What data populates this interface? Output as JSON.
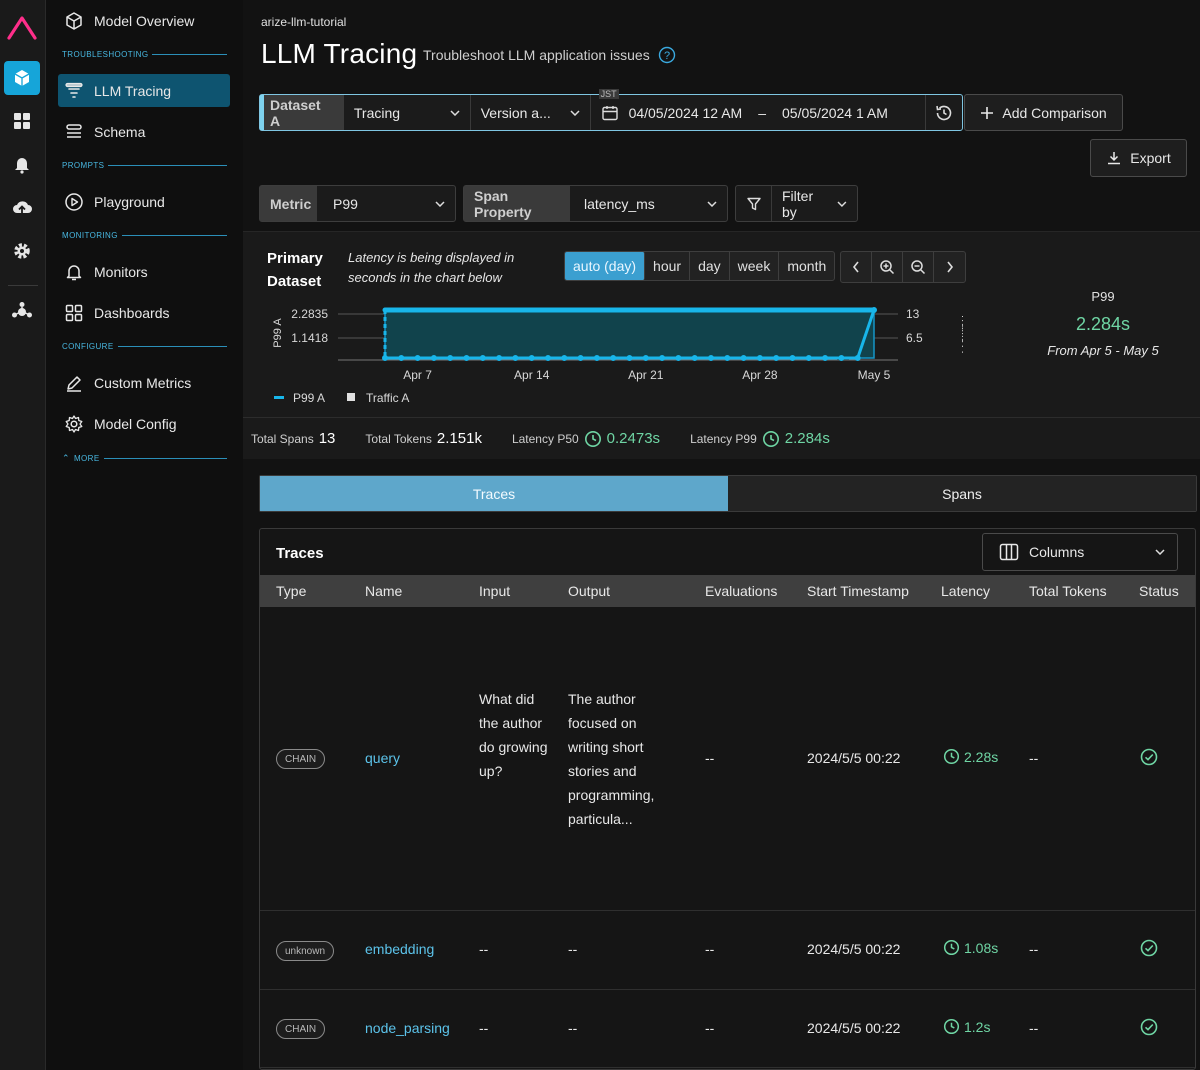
{
  "sidebar": {
    "items": [
      {
        "label": "Model Overview"
      },
      {
        "label": "LLM Tracing"
      },
      {
        "label": "Schema"
      },
      {
        "label": "Playground"
      },
      {
        "label": "Monitors"
      },
      {
        "label": "Dashboards"
      },
      {
        "label": "Custom Metrics"
      },
      {
        "label": "Model Config"
      }
    ],
    "sections": {
      "troubleshooting": "TROUBLESHOOTING",
      "prompts": "PROMPTS",
      "monitoring": "MONITORING",
      "configure": "CONFIGURE",
      "more": "MORE"
    }
  },
  "header": {
    "breadcrumb": "arize-llm-tutorial",
    "title": "LLM Tracing",
    "subtitle": "Troubleshoot LLM application issues"
  },
  "toolbar": {
    "dataset_label": "Dataset A",
    "dataset_value": "Tracing",
    "version_value": "Version a...",
    "timezone": "JST",
    "date_from": "04/05/2024 12 AM",
    "date_sep": "–",
    "date_to": "05/05/2024 1 AM",
    "add_comparison": "Add Comparison",
    "export": "Export",
    "metric_label": "Metric",
    "metric_value": "P99",
    "span_property_label": "Span Property",
    "span_property_value": "latency_ms",
    "filter_label": "Filter by"
  },
  "chart_panel": {
    "primary_label_1": "Primary",
    "primary_label_2": "Dataset",
    "note_1": "Latency is being displayed in",
    "note_2": "seconds in the chart below",
    "granularity": [
      "auto (day)",
      "hour",
      "day",
      "week",
      "month"
    ],
    "summary_metric": "P99",
    "summary_value": "2.284s",
    "summary_range": "From Apr 5 - May 5"
  },
  "chart_data": {
    "type": "line",
    "x": [
      "Apr 5",
      "Apr 6",
      "Apr 7",
      "Apr 8",
      "Apr 9",
      "Apr 10",
      "Apr 11",
      "Apr 12",
      "Apr 13",
      "Apr 14",
      "Apr 15",
      "Apr 16",
      "Apr 17",
      "Apr 18",
      "Apr 19",
      "Apr 20",
      "Apr 21",
      "Apr 22",
      "Apr 23",
      "Apr 24",
      "Apr 25",
      "Apr 26",
      "Apr 27",
      "Apr 28",
      "Apr 29",
      "Apr 30",
      "May 1",
      "May 2",
      "May 3",
      "May 4",
      "May 5"
    ],
    "x_tick_labels": [
      "Apr 7",
      "Apr 14",
      "Apr 21",
      "Apr 28",
      "May 5"
    ],
    "ylabel": "P99 A",
    "y2label": "Traffic A",
    "y_ticks": [
      "2.2835",
      "1.1418"
    ],
    "y2_ticks": [
      "13",
      "6.5"
    ],
    "ylim": [
      0,
      2.2835
    ],
    "y2lim": [
      0,
      13
    ],
    "series": [
      {
        "name": "P99 A",
        "axis": "left",
        "values": [
          2.2835,
          2.2835,
          2.2835,
          2.2835,
          2.2835,
          2.2835,
          2.2835,
          2.2835,
          2.2835,
          2.2835,
          2.2835,
          2.2835,
          2.2835,
          2.2835,
          2.2835,
          2.2835,
          2.2835,
          2.2835,
          2.2835,
          2.2835,
          2.2835,
          2.2835,
          2.2835,
          2.2835,
          2.2835,
          2.2835,
          2.2835,
          2.2835,
          2.2835,
          2.2835,
          2.2835
        ]
      },
      {
        "name": "Traffic A",
        "axis": "right",
        "values": [
          0,
          0,
          0,
          0,
          0,
          0,
          0,
          0,
          0,
          0,
          0,
          0,
          0,
          0,
          0,
          0,
          0,
          0,
          0,
          0,
          0,
          0,
          0,
          0,
          0,
          0,
          0,
          0,
          0,
          0,
          13
        ]
      }
    ],
    "legend": "bottom-left",
    "grid": true
  },
  "stats": {
    "total_spans_label": "Total Spans",
    "total_spans": "13",
    "total_tokens_label": "Total Tokens",
    "total_tokens": "2.151k",
    "p50_label": "Latency P50",
    "p50": "0.2473s",
    "p99_label": "Latency P99",
    "p99": "2.284s"
  },
  "tabs": [
    "Traces",
    "Spans"
  ],
  "traces": {
    "title": "Traces",
    "columns_button": "Columns",
    "headers": [
      "Type",
      "Name",
      "Input",
      "Output",
      "Evaluations",
      "Start Timestamp",
      "Latency",
      "Total Tokens",
      "Status"
    ],
    "rows": [
      {
        "type": "CHAIN",
        "name": "query",
        "input": "What did the author do growing up?",
        "output": "The author focused on writing short stories and programming, particula...",
        "evaluations": "--",
        "start": "2024/5/5 00:22",
        "latency": "2.28s",
        "tokens": "--"
      },
      {
        "type": "unknown",
        "name": "embedding",
        "input": "--",
        "output": "--",
        "evaluations": "--",
        "start": "2024/5/5 00:22",
        "latency": "1.08s",
        "tokens": "--"
      },
      {
        "type": "CHAIN",
        "name": "node_parsing",
        "input": "--",
        "output": "--",
        "evaluations": "--",
        "start": "2024/5/5 00:22",
        "latency": "1.2s",
        "tokens": "--"
      }
    ]
  }
}
